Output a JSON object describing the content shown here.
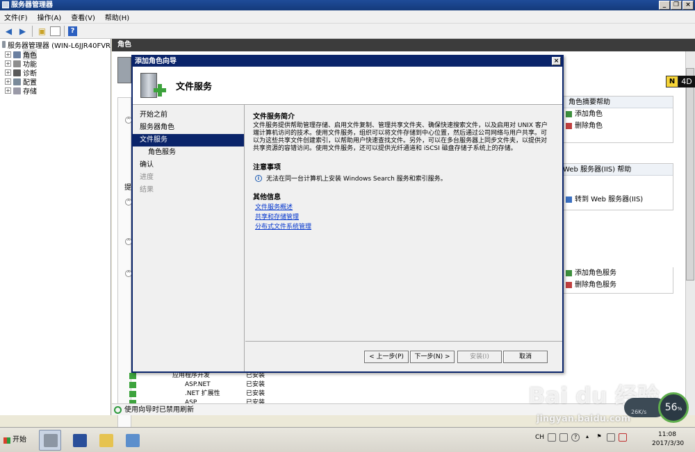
{
  "window": {
    "title": "服务器管理器"
  },
  "menu": [
    "文件(F)",
    "操作(A)",
    "查看(V)",
    "帮助(H)"
  ],
  "tree": {
    "root": "服务器管理器 (WIN-L6JJR40FVR",
    "items": [
      {
        "label": "角色",
        "selected": true
      },
      {
        "label": "功能"
      },
      {
        "label": "诊断"
      },
      {
        "label": "配置"
      },
      {
        "label": "存储"
      }
    ]
  },
  "main": {
    "header": "角色"
  },
  "right_panels": {
    "roles_help": "角色摘要帮助",
    "add_role": "添加角色",
    "remove_role": "删除角色",
    "web_help": "Web 服务器(IIS) 帮助",
    "goto_web": "转到 Web 服务器(IIS)",
    "add_service": "添加角色服务",
    "remove_service": "删除角色服务"
  },
  "background_rows": [
    {
      "name": "应用程序开发",
      "status": "已安装"
    },
    {
      "name": "ASP.NET",
      "status": "已安装"
    },
    {
      "name": ".NET 扩展性",
      "status": "已安装"
    },
    {
      "name": "ASP",
      "status": "已安装"
    }
  ],
  "bg_fragment": "提",
  "status_text": "使用向导时已禁用刷新",
  "dialog": {
    "title": "添加角色向导",
    "heading": "文件服务",
    "steps": [
      {
        "label": "开始之前",
        "state": "normal"
      },
      {
        "label": "服务器角色",
        "state": "normal"
      },
      {
        "label": "文件服务",
        "state": "current"
      },
      {
        "label": "角色服务",
        "state": "sub"
      },
      {
        "label": "确认",
        "state": "normal"
      },
      {
        "label": "进度",
        "state": "disabled"
      },
      {
        "label": "结果",
        "state": "disabled"
      }
    ],
    "intro_title": "文件服务简介",
    "intro_text": "文件服务提供帮助管理存储、启用文件复制、管理共享文件夹、确保快速搜索文件，以及启用对 UNIX 客户端计算机访问的技术。使用文件服务，组织可以将文件存储到中心位置，然后通过公司网络与用户共享。可以为这些共享文件创建索引，以帮助用户快速查找文件。另外，可以在多台服务器上同步文件夹，以提供对共享资源的容错访问。使用文件服务，还可以提供光纤通道和 iSCSI 磁盘存储子系统上的存储。",
    "notes_title": "注意事项",
    "note_text": "无法在同一台计算机上安装 Windows Search 服务和索引服务。",
    "more_title": "其他信息",
    "links": [
      "文件服务概述",
      "共享和存储管理",
      "分布式文件系统管理"
    ],
    "buttons": {
      "prev": "< 上一步(P)",
      "next": "下一步(N) >",
      "install": "安装(I)",
      "cancel": "取消"
    }
  },
  "taskbar": {
    "start": "开始",
    "lang": "CH",
    "time": "11:08",
    "date": "2017/3/30"
  },
  "overlay": {
    "watermark": "Bai du 经验",
    "watermark_url": "jingyan.baidu.com",
    "speed_label": "26K/s",
    "speed_value": "56",
    "speed_unit": "%",
    "badge_n": "N",
    "badge_text": "4D"
  }
}
